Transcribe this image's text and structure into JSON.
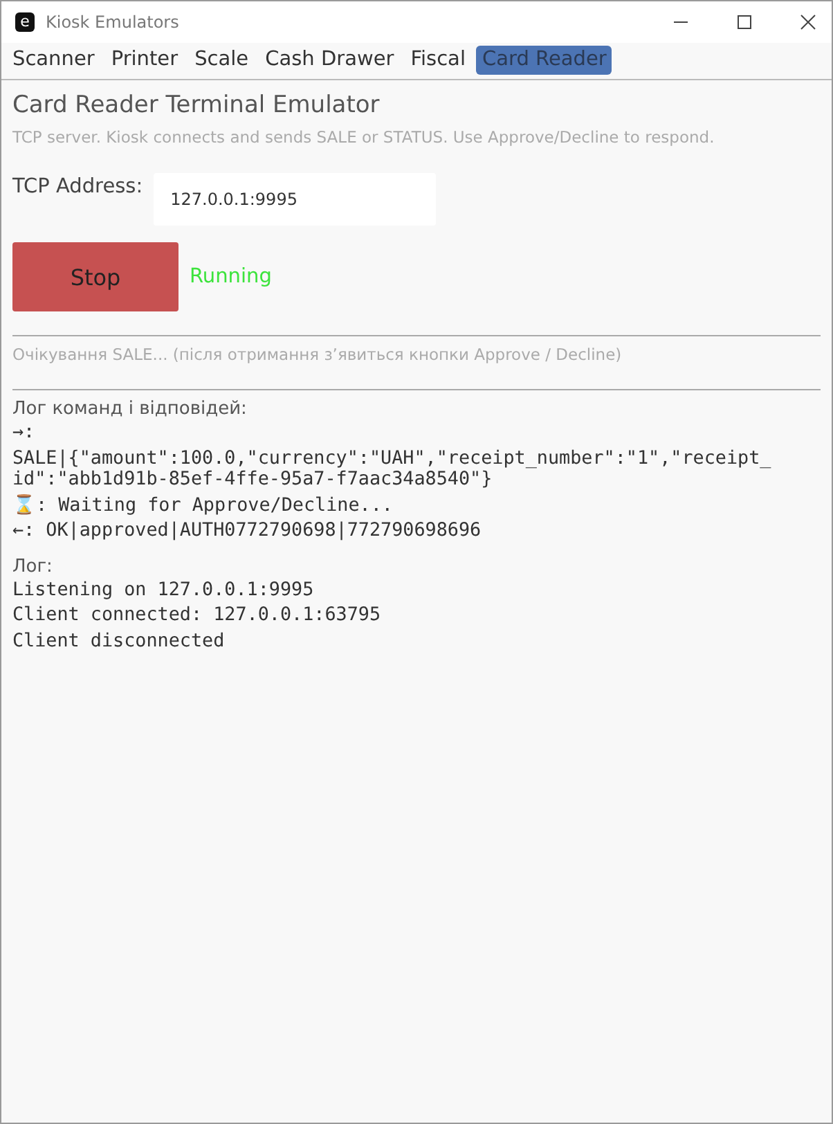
{
  "window": {
    "title": "Kiosk Emulators",
    "app_icon_letter": "e"
  },
  "tabs": [
    {
      "label": "Scanner",
      "selected": false
    },
    {
      "label": "Printer",
      "selected": false
    },
    {
      "label": "Scale",
      "selected": false
    },
    {
      "label": "Cash Drawer",
      "selected": false
    },
    {
      "label": "Fiscal",
      "selected": false
    },
    {
      "label": "Card Reader",
      "selected": true
    }
  ],
  "heading": "Card Reader Terminal Emulator",
  "description": "TCP server. Kiosk connects and sends SALE or STATUS. Use Approve/Decline to respond.",
  "address": {
    "label": "TCP Address:",
    "value": "127.0.0.1:9995"
  },
  "server": {
    "button": "Stop",
    "status": "Running",
    "running": true
  },
  "waiting_hint": "Очікування SALE... (після отримання зʼявиться кнопки Approve / Decline)",
  "command_log": {
    "label": "Лог команд і відповідей:",
    "lines": [
      "→:",
      "SALE|{\"amount\":100.0,\"currency\":\"UAH\",\"receipt_number\":\"1\",\"receipt_id\":\"abb1d91b-85ef-4ffe-95a7-f7aac34a8540\"}",
      "⌛: Waiting for Approve/Decline...",
      "←: OK|approved|AUTH0772790698|772790698696"
    ]
  },
  "log": {
    "label": "Лог:",
    "lines": [
      "Listening on 127.0.0.1:9995",
      "Client connected: 127.0.0.1:63795",
      "Client disconnected"
    ]
  }
}
